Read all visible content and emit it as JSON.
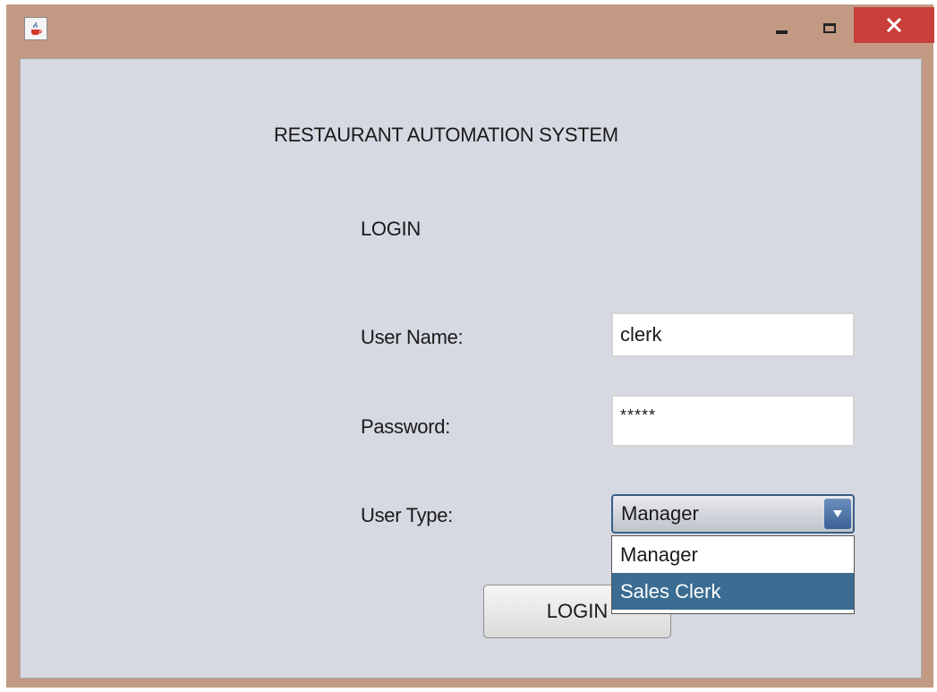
{
  "window": {
    "icon": "java-cup-icon",
    "controls": {
      "minimize_icon": "minimize-icon",
      "maximize_icon": "maximize-icon",
      "close_icon": "close-icon"
    },
    "frame_color": "#c29a83",
    "close_color": "#c9403b"
  },
  "form": {
    "heading": "RESTAURANT AUTOMATION SYSTEM",
    "subheading": "LOGIN",
    "username_label": "User Name:",
    "username_value": "clerk",
    "password_label": "Password:",
    "password_value": "*****",
    "usertype_label": "User Type:",
    "usertype_selected": "Manager",
    "usertype_options": [
      "Manager",
      "Sales Clerk"
    ],
    "usertype_highlighted": "Sales Clerk",
    "login_button": "LOGIN",
    "background_color": "#d6d9e2",
    "accent_color": "#3b6c92"
  }
}
